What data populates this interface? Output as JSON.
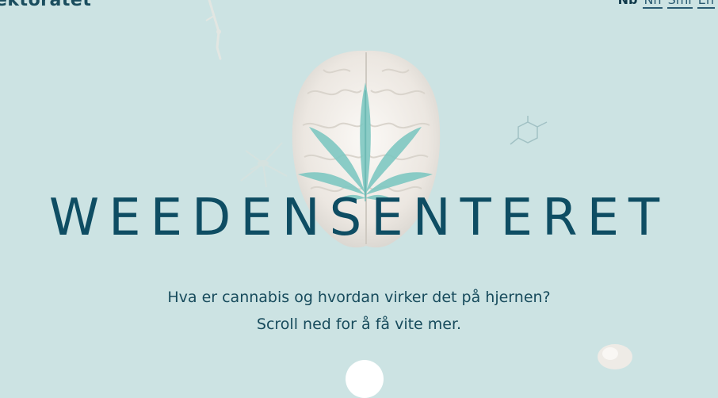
{
  "header": {
    "logo_text": "ektoratet",
    "languages": [
      {
        "label": "Nb",
        "active": true
      },
      {
        "label": "Nn",
        "active": false
      },
      {
        "label": "Sml",
        "active": false
      },
      {
        "label": "En",
        "active": false
      }
    ]
  },
  "hero": {
    "title": "WEEDENSENTERET",
    "subtitle_line1": "Hva er cannabis og hvordan virker det på hjernen?",
    "subtitle_line2": "Scroll ned for å få vite mer."
  },
  "colors": {
    "background": "#cce3e3",
    "title": "#0e4d63",
    "leaf": "#7fc8c2",
    "brain": "#f1eeea"
  },
  "icons": {
    "brain": "brain-illustration",
    "leaf": "cannabis-leaf-icon",
    "molecule": "molecule-icon",
    "scroll": "scroll-down-button"
  }
}
